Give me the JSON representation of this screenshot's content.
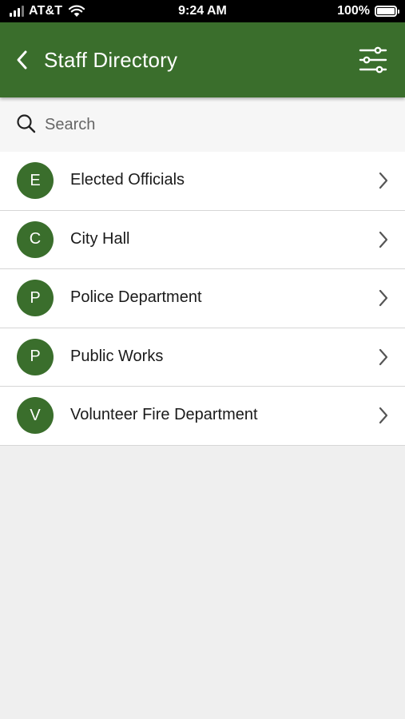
{
  "status_bar": {
    "carrier": "AT&T",
    "time": "9:24 AM",
    "battery": "100%",
    "icons": [
      "signal-icon",
      "wifi-icon",
      "battery-icon"
    ]
  },
  "header": {
    "title": "Staff Directory",
    "back_icon": "chevron-left-icon",
    "filter_icon": "sliders-icon",
    "color": "#3a6e2c"
  },
  "search": {
    "placeholder": "Search",
    "value": "",
    "icon": "search-icon"
  },
  "directory": {
    "items": [
      {
        "initial": "E",
        "label": "Elected Officials"
      },
      {
        "initial": "C",
        "label": "City Hall"
      },
      {
        "initial": "P",
        "label": "Police Department"
      },
      {
        "initial": "P",
        "label": "Public Works"
      },
      {
        "initial": "V",
        "label": "Volunteer Fire Department"
      }
    ]
  }
}
